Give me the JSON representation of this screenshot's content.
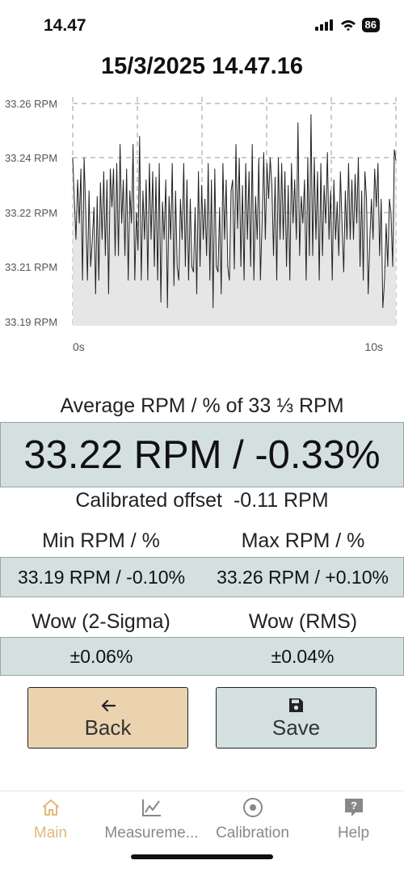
{
  "status": {
    "time": "14.47",
    "battery": "86"
  },
  "header": {
    "timestamp": "15/3/2025 14.47.16"
  },
  "chart_data": {
    "type": "area",
    "y_tick_labels": [
      "33.26 RPM",
      "33.24 RPM",
      "33.22 RPM",
      "33.21 RPM",
      "33.19 RPM"
    ],
    "y_ticks": [
      33.26,
      33.24,
      33.22,
      33.21,
      33.19
    ],
    "x_tick_labels": [
      "0s",
      "10s"
    ],
    "xlim": [
      0,
      10
    ],
    "grid": true,
    "line_color": "#222222",
    "fill_color": "#e6e6e6",
    "values": [
      33.24,
      33.225,
      33.215,
      33.232,
      33.218,
      33.236,
      33.205,
      33.24,
      33.22,
      33.205,
      33.228,
      33.21,
      33.215,
      33.222,
      33.2,
      33.226,
      33.205,
      33.231,
      33.215,
      33.235,
      33.212,
      33.232,
      33.2,
      33.236,
      33.222,
      33.236,
      33.212,
      33.238,
      33.212,
      33.245,
      33.218,
      33.232,
      33.212,
      33.236,
      33.205,
      33.228,
      33.218,
      33.245,
      33.205,
      33.22,
      33.213,
      33.248,
      33.205,
      33.228,
      33.215,
      33.232,
      33.205,
      33.238,
      33.215,
      33.235,
      33.21,
      33.233,
      33.205,
      33.238,
      33.197,
      33.224,
      33.215,
      33.232,
      33.195,
      33.226,
      33.215,
      33.238,
      33.203,
      33.228,
      33.21,
      33.205,
      33.225,
      33.215,
      33.238,
      33.21,
      33.232,
      33.205,
      33.225,
      33.21,
      33.208,
      33.222,
      33.2,
      33.235,
      33.21,
      33.23,
      33.215,
      33.225,
      33.212,
      33.238,
      33.205,
      33.232,
      33.195,
      33.236,
      33.21,
      33.208,
      33.222,
      33.2,
      33.238,
      33.215,
      33.232,
      33.21,
      33.205,
      33.228,
      33.232,
      33.209,
      33.245,
      33.217,
      33.24,
      33.21,
      33.23,
      33.205,
      33.238,
      33.215,
      33.235,
      33.21,
      33.245,
      33.205,
      33.226,
      33.215,
      33.24,
      33.205,
      33.218,
      33.242,
      33.215,
      33.238,
      33.225,
      33.24,
      33.23,
      33.212,
      33.233,
      33.205,
      33.24,
      33.215,
      33.238,
      33.215,
      33.235,
      33.21,
      33.23,
      33.205,
      33.238,
      33.218,
      33.232,
      33.215,
      33.253,
      33.212,
      33.226,
      33.218,
      33.232,
      33.205,
      33.24,
      33.212,
      33.256,
      33.212,
      33.24,
      33.215,
      33.235,
      33.205,
      33.238,
      33.212,
      33.23,
      33.218,
      33.242,
      33.215,
      33.228,
      33.205,
      33.232,
      33.215,
      33.224,
      33.212,
      33.235,
      33.218,
      33.208,
      33.228,
      33.215,
      33.238,
      33.215,
      33.232,
      33.215,
      33.234,
      33.218,
      33.24,
      33.21,
      33.228,
      33.205,
      33.235,
      33.225,
      33.2,
      33.215,
      33.225,
      33.215,
      33.236,
      33.222,
      33.238,
      33.212,
      33.225,
      33.195,
      33.205,
      33.218,
      33.21,
      33.225,
      33.22,
      33.21,
      33.243,
      33.239
    ]
  },
  "summary": {
    "avg_label": "Average RPM / % of 33 ⅓ RPM",
    "avg_value": "33.22 RPM / -0.33%",
    "offset_label": "Calibrated offset",
    "offset_value": "-0.11 RPM",
    "min_label": "Min RPM / %",
    "max_label": "Max RPM / %",
    "min_value": "33.19 RPM / -0.10%",
    "max_value": "33.26 RPM / +0.10%",
    "wow2_label": "Wow (2-Sigma)",
    "wowrms_label": "Wow (RMS)",
    "wow2_value": "±0.06%",
    "wowrms_value": "±0.04%"
  },
  "buttons": {
    "back": "Back",
    "save": "Save"
  },
  "tabs": [
    {
      "label": "Main",
      "icon": "home-icon",
      "active": true
    },
    {
      "label": "Measureme...",
      "icon": "chart-line-icon",
      "active": false
    },
    {
      "label": "Calibration",
      "icon": "target-icon",
      "active": false
    },
    {
      "label": "Help",
      "icon": "help-icon",
      "active": false
    }
  ],
  "colors": {
    "accent": "#e0b979",
    "panel": "#d4e0e0",
    "back_button": "#ecd3b0"
  }
}
